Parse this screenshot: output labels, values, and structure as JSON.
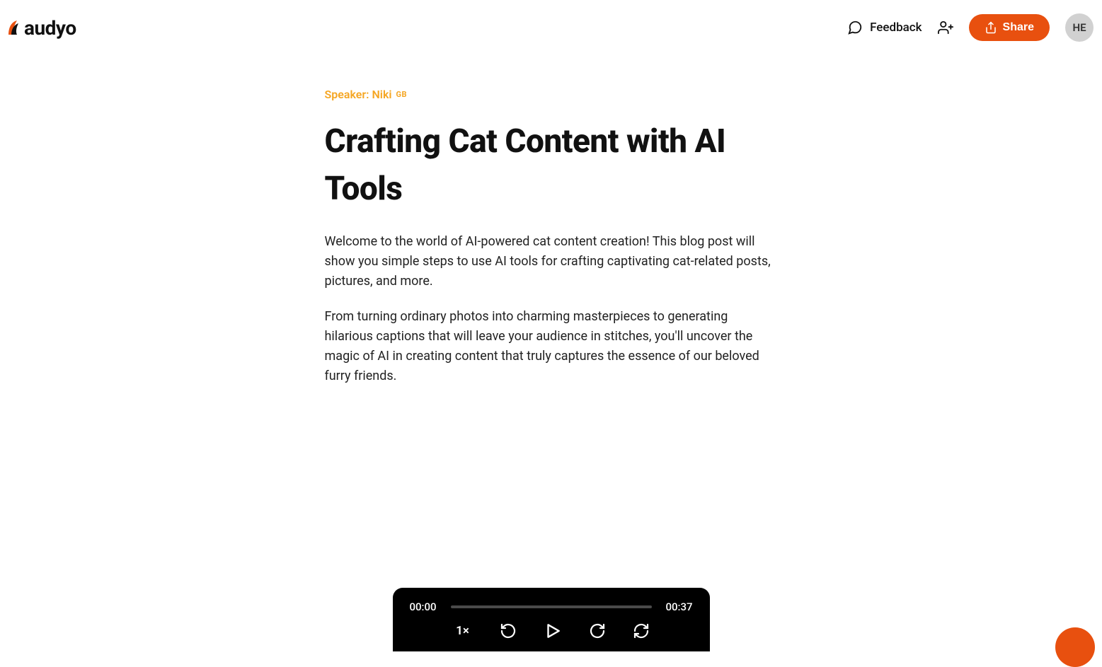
{
  "brand": "audyo",
  "header": {
    "feedback": "Feedback",
    "share": "Share",
    "avatar_initials": "HE"
  },
  "document": {
    "speaker_label": "Speaker: Niki",
    "speaker_region": "GB",
    "title": "Crafting Cat Content with AI Tools",
    "paragraphs": [
      "Welcome to the world of AI-powered cat content creation! This blog post will show you simple steps to use AI tools for crafting captivating cat-related posts, pictures, and more.",
      "From turning ordinary photos into charming masterpieces to generating hilarious captions that will leave your audience in stitches, you'll uncover the magic of AI in creating content that truly captures the essence of our beloved furry friends."
    ]
  },
  "player": {
    "current_time": "00:00",
    "duration": "00:37",
    "speed": "1×"
  },
  "colors": {
    "accent": "#e8500f"
  }
}
